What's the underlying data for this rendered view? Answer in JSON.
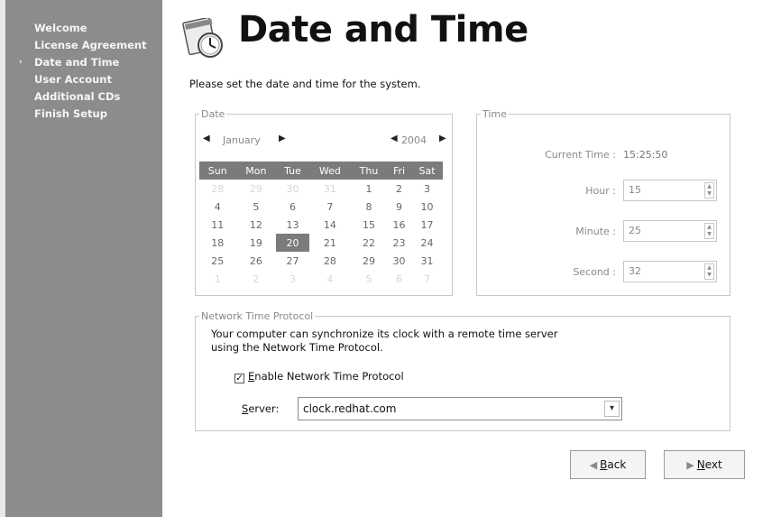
{
  "sidebar": {
    "items": [
      {
        "label": "Welcome",
        "current": false
      },
      {
        "label": "License Agreement",
        "current": false
      },
      {
        "label": "Date and Time",
        "current": true
      },
      {
        "label": "User Account",
        "current": false
      },
      {
        "label": "Additional CDs",
        "current": false
      },
      {
        "label": "Finish Setup",
        "current": false
      }
    ],
    "current_marker": "›"
  },
  "header": {
    "title": "Date and Time",
    "icon": "clock-calendar-icon"
  },
  "intro_text": "Please set the date and time for the system.",
  "date": {
    "legend": "Date",
    "month": "January",
    "year": "2004",
    "weekdays": [
      "Sun",
      "Mon",
      "Tue",
      "Wed",
      "Thu",
      "Fri",
      "Sat"
    ],
    "weeks": [
      [
        "28",
        "29",
        "30",
        "31",
        "1",
        "2",
        "3"
      ],
      [
        "4",
        "5",
        "6",
        "7",
        "8",
        "9",
        "10"
      ],
      [
        "11",
        "12",
        "13",
        "14",
        "15",
        "16",
        "17"
      ],
      [
        "18",
        "19",
        "20",
        "21",
        "22",
        "23",
        "24"
      ],
      [
        "25",
        "26",
        "27",
        "28",
        "29",
        "30",
        "31"
      ],
      [
        "1",
        "2",
        "3",
        "4",
        "5",
        "6",
        "7"
      ]
    ],
    "selected_day": "20"
  },
  "time": {
    "legend": "Time",
    "current_label": "Current Time :",
    "current_value": "15:25:50",
    "hour_label": "Hour :",
    "hour": "15",
    "minute_label": "Minute :",
    "minute": "25",
    "second_label": "Second :",
    "second": "32"
  },
  "ntp": {
    "legend": "Network Time Protocol",
    "desc_line1": "Your computer can synchronize its clock with a remote time server",
    "desc_line2": "using the Network Time Protocol.",
    "enable_label_mnemonic": "E",
    "enable_label_rest": "nable Network Time Protocol",
    "enable_checked": true,
    "server_label_mnemonic": "S",
    "server_label_rest": "erver:",
    "server_value": "clock.redhat.com"
  },
  "buttons": {
    "back_mnemonic": "B",
    "back_rest": "ack",
    "next_mnemonic": "N",
    "next_rest": "ext"
  }
}
